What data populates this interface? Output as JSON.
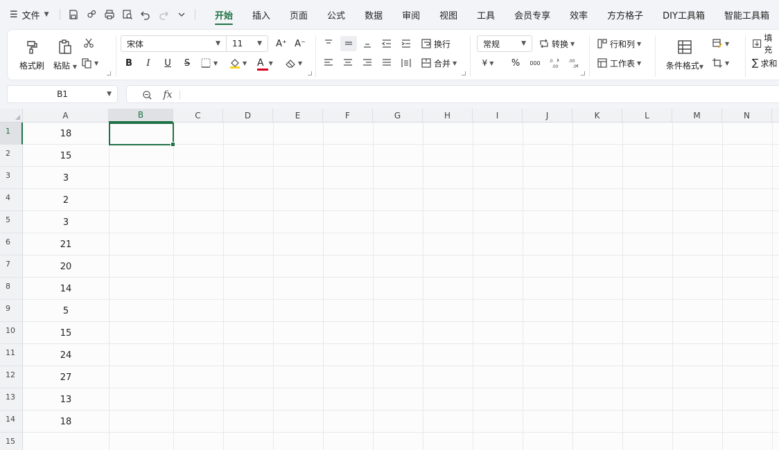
{
  "app": {
    "accent_color": "#1e7145",
    "file_menu_label": "文件"
  },
  "quick_access": [
    "save-icon",
    "share-icon",
    "print-icon",
    "print-preview-icon",
    "undo-icon",
    "redo-icon",
    "more-dropdown-icon"
  ],
  "tabs": [
    {
      "label": "开始",
      "active": true
    },
    {
      "label": "插入"
    },
    {
      "label": "页面"
    },
    {
      "label": "公式"
    },
    {
      "label": "数据"
    },
    {
      "label": "审阅"
    },
    {
      "label": "视图"
    },
    {
      "label": "工具"
    },
    {
      "label": "会员专享"
    },
    {
      "label": "效率"
    },
    {
      "label": "方方格子"
    },
    {
      "label": "DIY工具箱"
    },
    {
      "label": "智能工具箱"
    }
  ],
  "ribbon": {
    "format_painter": "格式刷",
    "paste": "粘贴",
    "font_name": "宋体",
    "font_size": "11",
    "bold": "B",
    "italic": "I",
    "underline": "U",
    "strikethrough": "S",
    "font_color_letter": "A",
    "increase_font": "A⁺",
    "decrease_font": "A⁻",
    "wrap_text": "换行",
    "merge": "合并",
    "number_format": "常规",
    "convert": "转换",
    "currency": "¥",
    "percent": "%",
    "thousands": "000",
    "row_col": "行和列",
    "worksheet": "工作表",
    "conditional_format": "条件格式",
    "fill": "填充",
    "sum": "求和"
  },
  "formula_bar": {
    "name_box": "B1",
    "fx_label": "fx",
    "formula": ""
  },
  "sheet": {
    "columns": [
      "A",
      "B",
      "C",
      "D",
      "E",
      "F",
      "G",
      "H",
      "I",
      "J",
      "K",
      "L",
      "M",
      "N"
    ],
    "selected_column": "B",
    "selected_row": 1,
    "row_numbers": [
      "1",
      "2",
      "3",
      "4",
      "5",
      "6",
      "7",
      "8",
      "9",
      "10",
      "11",
      "12",
      "13",
      "14",
      "15"
    ],
    "column_a_values": [
      "18",
      "15",
      "3",
      "2",
      "3",
      "21",
      "20",
      "14",
      "5",
      "15",
      "24",
      "27",
      "13",
      "18"
    ]
  }
}
